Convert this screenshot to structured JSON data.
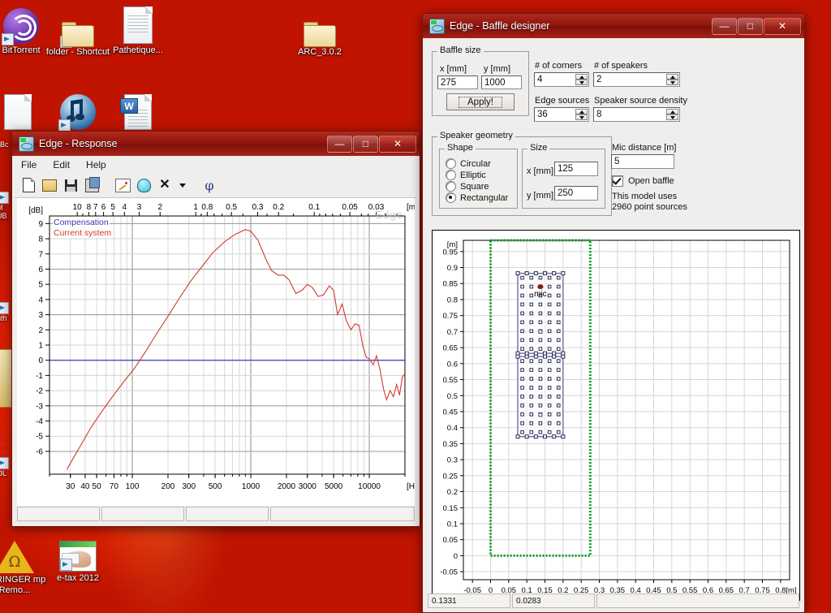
{
  "desktop": {
    "icons": [
      {
        "label": "BitTorrent",
        "type": "circle-app-icon",
        "shortcut": true
      },
      {
        "label": "folder - Shortcut",
        "type": "folder-icon",
        "shortcut": true
      },
      {
        "label": "Pathetique...",
        "type": "document-icon",
        "shortcut": false
      },
      {
        "label": "ARC_3.0.2",
        "type": "folder-icon",
        "shortcut": false
      },
      {
        "label": "",
        "type": "document-icon",
        "shortcut": false
      },
      {
        "label": "",
        "type": "itunes-icon",
        "shortcut": true
      },
      {
        "label": "",
        "type": "word-document-icon",
        "shortcut": false
      },
      {
        "label": "EHRINGER mp Remo...",
        "type": "warning-icon",
        "shortcut": false
      },
      {
        "label": "e-tax 2012",
        "type": "etax-icon",
        "shortcut": true
      }
    ]
  },
  "response_window": {
    "title": "Edge - Response",
    "app_icon": "edge-app-icon",
    "window_buttons": {
      "minimize": "—",
      "maximize": "□",
      "close": "✕"
    },
    "menu": [
      "File",
      "Edit",
      "Help"
    ],
    "toolbar": [
      {
        "name": "new-icon",
        "glyph": "new"
      },
      {
        "name": "open-icon",
        "glyph": "open"
      },
      {
        "name": "save-icon",
        "glyph": "save"
      },
      {
        "name": "copy-icon",
        "glyph": "copy"
      },
      {
        "name": "edit-compensation-icon",
        "glyph": "pencil"
      },
      {
        "name": "speaker-icon",
        "glyph": "speaker"
      },
      {
        "name": "delete-icon",
        "glyph": "x"
      },
      {
        "name": "dropdown-arrow-icon",
        "glyph": "caret"
      },
      {
        "name": "phase-icon",
        "glyph": "phi"
      }
    ],
    "watermark": "Edge",
    "status_panes": [
      "",
      "",
      "",
      ""
    ]
  },
  "chart_data": {
    "type": "line",
    "title": "Edge - Response",
    "xlabel": "[Hz]",
    "ylabel": "[dB]",
    "xscale": "log",
    "xlim": [
      20,
      20000
    ],
    "ylim": [
      -7.5,
      9.5
    ],
    "grid": true,
    "legend_position": "top-left",
    "x_ticks": [
      30,
      40,
      50,
      70,
      100,
      200,
      300,
      500,
      1000,
      2000,
      3000,
      5000,
      10000
    ],
    "x_tick_labels": [
      "30",
      "40",
      "50",
      "70",
      "100",
      "200",
      "300",
      "500",
      "1000",
      "2000",
      "3000",
      "5000",
      "10000"
    ],
    "y_ticks": [
      9,
      8,
      7,
      6,
      5,
      4,
      3,
      2,
      1,
      0,
      -1,
      -2,
      -3,
      -4,
      -5,
      -6
    ],
    "y_tick_labels": [
      "9",
      "8",
      "7",
      "6",
      "5",
      "4",
      "3",
      "2",
      "1",
      "0",
      "-1",
      "-2",
      "-3",
      "-4",
      "-5",
      "-6"
    ],
    "top_axis_label": "[m]",
    "top_axis_ticks": [
      10,
      8,
      7,
      6,
      5,
      4,
      3,
      2,
      1,
      0.8,
      0.5,
      0.3,
      0.2,
      0.1,
      0.05,
      0.03
    ],
    "top_axis_tick_labels": [
      "10",
      "8",
      "7",
      "6",
      "5",
      "4",
      "3",
      "2",
      "1",
      "0.8",
      "0.5",
      "0.3",
      "0.2",
      "0.1",
      "0.05",
      "0.03"
    ],
    "series": [
      {
        "name": "Compensation",
        "color": "#3a3ab4",
        "x": [
          20,
          20000
        ],
        "values": [
          0,
          0
        ]
      },
      {
        "name": "Current system",
        "color": "#d2382f",
        "x": [
          28,
          32,
          38,
          45,
          55,
          68,
          85,
          105,
          130,
          165,
          200,
          250,
          310,
          390,
          480,
          600,
          740,
          900,
          1000,
          1150,
          1350,
          1500,
          1700,
          1900,
          2100,
          2400,
          2700,
          3000,
          3300,
          3700,
          4100,
          4600,
          5000,
          5400,
          5900,
          6400,
          7000,
          7600,
          8200,
          8800,
          9400,
          10000,
          10800,
          11500,
          12300,
          13200,
          14000,
          15000,
          16000,
          17000,
          18000,
          19000,
          20000
        ],
        "values": [
          -7.2,
          -6.4,
          -5.4,
          -4.4,
          -3.4,
          -2.4,
          -1.4,
          -0.5,
          0.6,
          1.9,
          2.9,
          4.1,
          5.2,
          6.2,
          7.1,
          7.8,
          8.3,
          8.6,
          8.5,
          7.9,
          6.6,
          5.9,
          5.6,
          5.6,
          5.3,
          4.4,
          4.6,
          5.0,
          4.8,
          4.2,
          4.3,
          4.9,
          4.6,
          3.0,
          3.7,
          2.6,
          2.0,
          2.4,
          2.3,
          1.0,
          0.2,
          0.1,
          -0.3,
          0.3,
          -0.6,
          -1.9,
          -2.6,
          -2.0,
          -2.4,
          -1.6,
          -2.3,
          -1.1,
          -0.9
        ]
      }
    ]
  },
  "baffle_window": {
    "title": "Edge - Baffle designer",
    "app_icon": "edge-app-icon",
    "window_buttons": {
      "minimize": "—",
      "maximize": "□",
      "close": "✕"
    },
    "baffle_size": {
      "group_label": "Baffle size",
      "x_label": "x [mm]",
      "x_value": "275",
      "y_label": "y [mm]",
      "y_value": "1000",
      "apply_label": "Apply!"
    },
    "counts": {
      "corners_label": "# of corners",
      "corners_value": "4",
      "speakers_label": "# of speakers",
      "speakers_value": "2",
      "edge_sources_label": "Edge sources",
      "edge_sources_value": "36",
      "density_label": "Speaker source density",
      "density_value": "8"
    },
    "speaker_geometry": {
      "group_label": "Speaker geometry",
      "shape_label": "Shape",
      "shape_options": [
        "Circular",
        "Elliptic",
        "Square",
        "Rectangular"
      ],
      "shape_selected": "Rectangular",
      "size_label": "Size",
      "size_x_label": "x [mm]",
      "size_x_value": "125",
      "size_y_label": "y [mm]",
      "size_y_value": "250"
    },
    "mic": {
      "label": "Mic distance [m]",
      "value": "5",
      "open_baffle_label": "Open baffle",
      "open_baffle_checked": true,
      "model_note": "This model uses\n2960 point sources"
    },
    "plot": {
      "x_unit": "[m]",
      "y_unit": "[m]",
      "x_ticks": [
        "-0.05",
        "0",
        "0.05",
        "0.1",
        "0.15",
        "0.2",
        "0.25",
        "0.3",
        "0.35",
        "0.4",
        "0.45",
        "0.5",
        "0.55",
        "0.6",
        "0.65",
        "0.7",
        "0.75",
        "0.8"
      ],
      "y_ticks": [
        "0.95",
        "0.9",
        "0.85",
        "0.8",
        "0.75",
        "0.7",
        "0.65",
        "0.6",
        "0.55",
        "0.5",
        "0.45",
        "0.4",
        "0.35",
        "0.3",
        "0.25",
        "0.2",
        "0.15",
        "0.1",
        "0.05",
        "0",
        "-0.05"
      ],
      "mic_label": "mic",
      "baffle_color": "#0b9c1f",
      "speaker_color": "#6b6fa8",
      "mic_color": "#8b1a10"
    },
    "status_panes": [
      "0.1331",
      "0.0283",
      ""
    ]
  }
}
